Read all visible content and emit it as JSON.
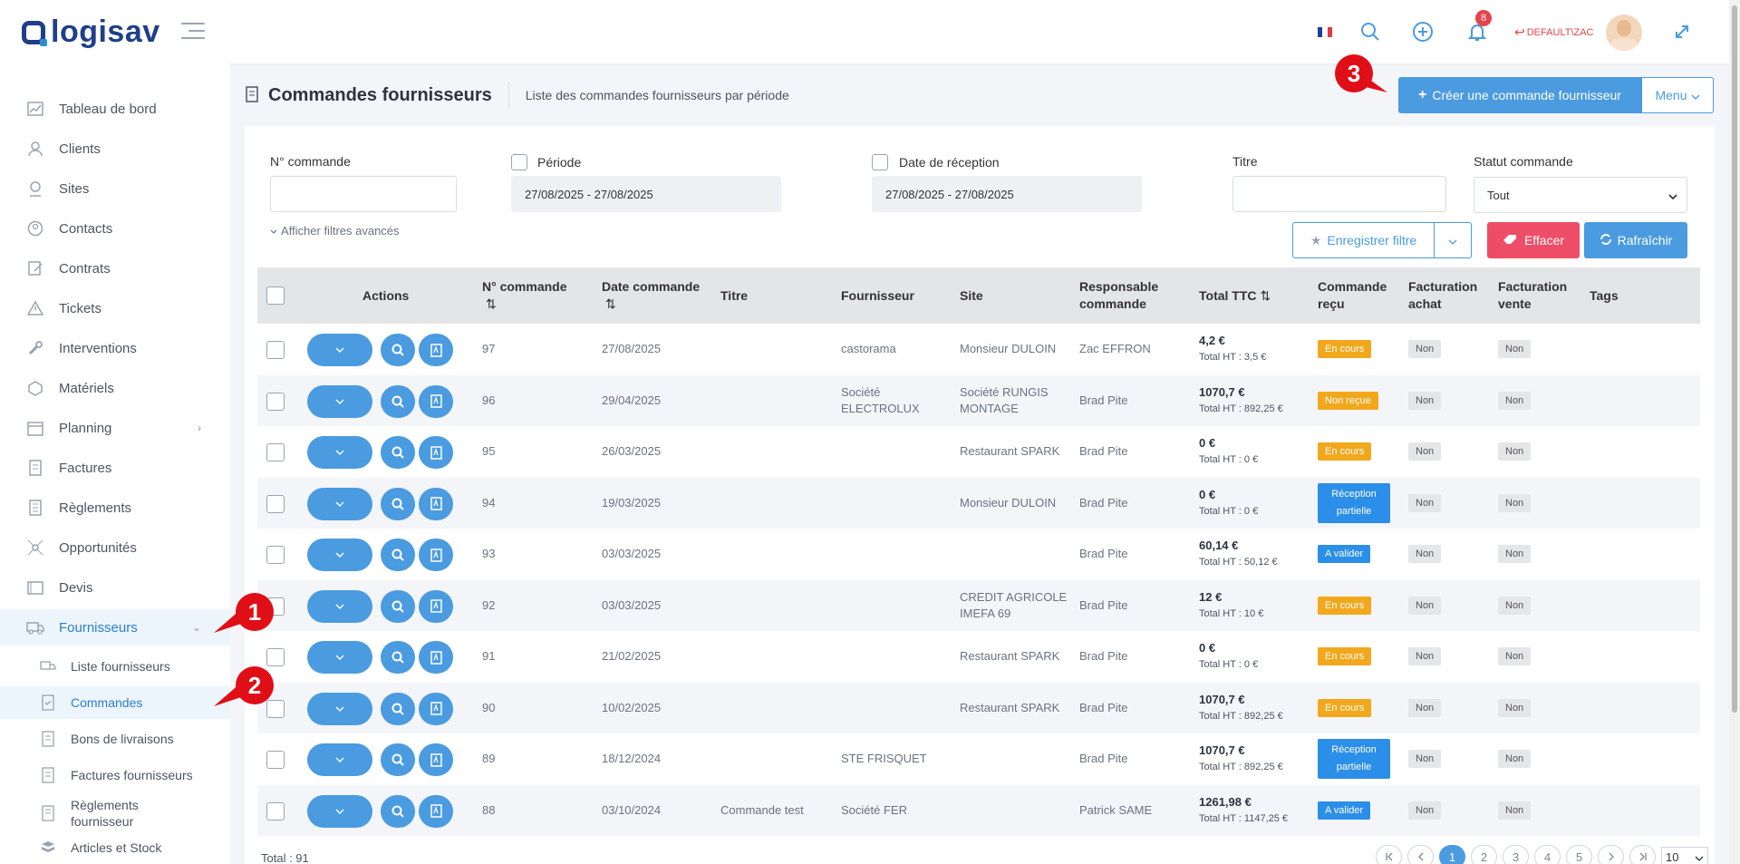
{
  "app": {
    "logo_text": "logisav"
  },
  "topbar": {
    "notifications_count": "8",
    "user_label": "DEFAULT\\ZAC",
    "flag_colors": [
      "#1f3f9f",
      "#ffffff",
      "#e33a3a"
    ]
  },
  "sidebar": {
    "items": [
      {
        "label": "Tableau de bord",
        "icon": "dashboard-icon"
      },
      {
        "label": "Clients",
        "icon": "clients-icon"
      },
      {
        "label": "Sites",
        "icon": "sites-icon"
      },
      {
        "label": "Contacts",
        "icon": "contacts-icon"
      },
      {
        "label": "Contrats",
        "icon": "contracts-icon"
      },
      {
        "label": "Tickets",
        "icon": "tickets-icon"
      },
      {
        "label": "Interventions",
        "icon": "wrench-icon"
      },
      {
        "label": "Matériels",
        "icon": "box-icon"
      },
      {
        "label": "Planning",
        "icon": "calendar-icon"
      },
      {
        "label": "Factures",
        "icon": "invoice-icon"
      },
      {
        "label": "Règlements",
        "icon": "payment-icon"
      },
      {
        "label": "Opportunités",
        "icon": "opportunity-icon"
      },
      {
        "label": "Devis",
        "icon": "quote-icon"
      },
      {
        "label": "Fournisseurs",
        "icon": "truck-icon"
      }
    ],
    "sub_items": [
      {
        "label": "Liste fournisseurs"
      },
      {
        "label": "Commandes"
      },
      {
        "label": "Bons de livraisons"
      },
      {
        "label": "Factures fournisseurs"
      },
      {
        "label": "Règlements fournisseur"
      },
      {
        "label": "Articles et Stock"
      }
    ]
  },
  "header": {
    "title": "Commandes fournisseurs",
    "subtitle": "Liste des commandes fournisseurs par période",
    "create_label": "Créer une commande fournisseur",
    "menu_label": "Menu"
  },
  "filters": {
    "order_no_label": "N° commande",
    "order_no_value": "",
    "period_label": "Période",
    "period_value": "27/08/2025 - 27/08/2025",
    "reception_label": "Date de réception",
    "reception_value": "27/08/2025 - 27/08/2025",
    "title_label": "Titre",
    "title_value": "",
    "status_label": "Statut commande",
    "status_value": "Tout",
    "advanced_label": "Afficher filtres avancés",
    "save_label": "Enregistrer filtre",
    "clear_label": "Effacer",
    "refresh_label": "Rafraîchir"
  },
  "table": {
    "headers": {
      "actions": "Actions",
      "order_no": "N° commande",
      "date": "Date commande",
      "title": "Titre",
      "supplier": "Fournisseur",
      "site": "Site",
      "manager": "Responsable commande",
      "total": "Total TTC",
      "received": "Commande reçu",
      "purchase_billing": "Facturation achat",
      "sales_billing": "Facturation vente",
      "tags": "Tags"
    },
    "rows": [
      {
        "no": "97",
        "date": "27/08/2025",
        "title": "",
        "supplier": "castorama",
        "site": "Monsieur DULOIN",
        "manager": "Zac EFFRON",
        "ttc": "4,2 €",
        "ht": "Total HT : 3,5 €",
        "status": "En cours",
        "status_color": "orange",
        "purchase": "Non",
        "sale": "Non"
      },
      {
        "no": "96",
        "date": "29/04/2025",
        "title": "",
        "supplier": "Société ELECTROLUX",
        "site": "Société RUNGIS MONTAGE",
        "manager": "Brad Pite",
        "ttc": "1070,7 €",
        "ht": "Total HT : 892,25 €",
        "status": "Non reçue",
        "status_color": "orange",
        "purchase": "Non",
        "sale": "Non"
      },
      {
        "no": "95",
        "date": "26/03/2025",
        "title": "",
        "supplier": "",
        "site": "Restaurant SPARK",
        "manager": "Brad Pite",
        "ttc": "0 €",
        "ht": "Total HT : 0 €",
        "status": "En cours",
        "status_color": "orange",
        "purchase": "Non",
        "sale": "Non"
      },
      {
        "no": "94",
        "date": "19/03/2025",
        "title": "",
        "supplier": "",
        "site": "Monsieur DULOIN",
        "manager": "Brad Pite",
        "ttc": "0 €",
        "ht": "Total HT : 0 €",
        "status": "Réception partielle",
        "status_color": "blue",
        "purchase": "Non",
        "sale": "Non"
      },
      {
        "no": "93",
        "date": "03/03/2025",
        "title": "",
        "supplier": "",
        "site": "",
        "manager": "Brad Pite",
        "ttc": "60,14 €",
        "ht": "Total HT : 50,12 €",
        "status": "A valider",
        "status_color": "blue",
        "purchase": "Non",
        "sale": "Non"
      },
      {
        "no": "92",
        "date": "03/03/2025",
        "title": "",
        "supplier": "",
        "site": "CREDIT AGRICOLE IMEFA 69",
        "manager": "Brad Pite",
        "ttc": "12 €",
        "ht": "Total HT : 10 €",
        "status": "En cours",
        "status_color": "orange",
        "purchase": "Non",
        "sale": "Non"
      },
      {
        "no": "91",
        "date": "21/02/2025",
        "title": "",
        "supplier": "",
        "site": "Restaurant SPARK",
        "manager": "Brad Pite",
        "ttc": "0 €",
        "ht": "Total HT : 0 €",
        "status": "En cours",
        "status_color": "orange",
        "purchase": "Non",
        "sale": "Non"
      },
      {
        "no": "90",
        "date": "10/02/2025",
        "title": "",
        "supplier": "",
        "site": "Restaurant SPARK",
        "manager": "Brad Pite",
        "ttc": "1070,7 €",
        "ht": "Total HT : 892,25 €",
        "status": "En cours",
        "status_color": "orange",
        "purchase": "Non",
        "sale": "Non"
      },
      {
        "no": "89",
        "date": "18/12/2024",
        "title": "",
        "supplier": "STE FRISQUET",
        "site": "",
        "manager": "Brad Pite",
        "ttc": "1070,7 €",
        "ht": "Total HT : 892,25 €",
        "status": "Réception partielle",
        "status_color": "blue",
        "purchase": "Non",
        "sale": "Non"
      },
      {
        "no": "88",
        "date": "03/10/2024",
        "title": "Commande test",
        "supplier": "Société FER",
        "site": "",
        "manager": "Patrick SAME",
        "ttc": "1261,98 €",
        "ht": "Total HT : 1147,25 €",
        "status": "A valider",
        "status_color": "blue",
        "purchase": "Non",
        "sale": "Non"
      }
    ]
  },
  "footer": {
    "total": "Total : 91",
    "pages": [
      "1",
      "2",
      "3",
      "4",
      "5"
    ],
    "current_page": "1",
    "page_size": "10"
  },
  "callouts": [
    "1",
    "2",
    "3"
  ]
}
